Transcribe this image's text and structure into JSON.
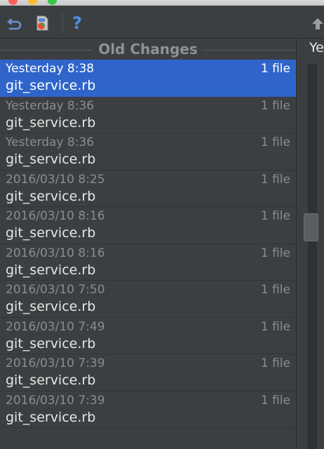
{
  "toolbar": {
    "undo_icon": "undo-arrow-icon",
    "revert_icon": "revert-file-icon",
    "help_label": "?"
  },
  "left_panel": {
    "group_title": "Old Changes",
    "entries": [
      {
        "time": "Yesterday 8:38",
        "count": "1 file",
        "file": "git_service.rb",
        "selected": true
      },
      {
        "time": "Yesterday 8:36",
        "count": "1 file",
        "file": "git_service.rb"
      },
      {
        "time": "Yesterday 8:36",
        "count": "1 file",
        "file": "git_service.rb"
      },
      {
        "time": "2016/03/10 8:25",
        "count": "1 file",
        "file": "git_service.rb"
      },
      {
        "time": "2016/03/10 8:16",
        "count": "1 file",
        "file": "git_service.rb"
      },
      {
        "time": "2016/03/10 8:16",
        "count": "1 file",
        "file": "git_service.rb"
      },
      {
        "time": "2016/03/10 7:50",
        "count": "1 file",
        "file": "git_service.rb"
      },
      {
        "time": "2016/03/10 7:49",
        "count": "1 file",
        "file": "git_service.rb"
      },
      {
        "time": "2016/03/10 7:39",
        "count": "1 file",
        "file": "git_service.rb"
      },
      {
        "time": "2016/03/10 7:39",
        "count": "1 file",
        "file": "git_service.rb"
      }
    ]
  },
  "right_panel": {
    "title": "Ye"
  },
  "colors": {
    "background": "#3c3f41",
    "selection": "#2f65ca",
    "muted_text": "#8a8c8e",
    "text": "#e6e6e6"
  }
}
